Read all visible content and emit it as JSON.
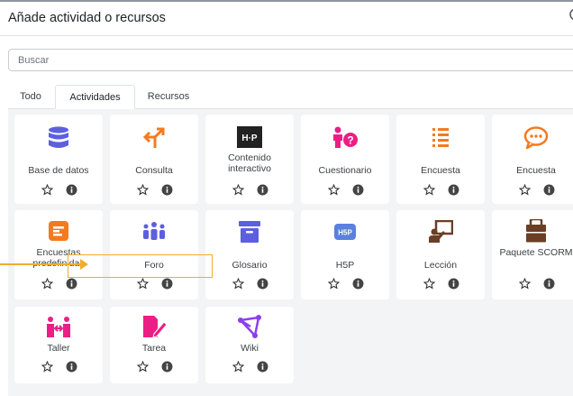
{
  "dialog": {
    "title": "Añade actividad o recursos",
    "close_icon": "close-icon"
  },
  "search": {
    "placeholder": "Buscar",
    "value": ""
  },
  "tabs": [
    {
      "label": "Todo",
      "active": false
    },
    {
      "label": "Actividades",
      "active": true
    },
    {
      "label": "Recursos",
      "active": false
    }
  ],
  "colors": {
    "blue": "#5b5fe0",
    "orange": "#f47a20",
    "pink": "#ec1e85",
    "purple": "#8b3ff0",
    "h5p_dark": "#222222",
    "h5p_blue": "#5a80e0",
    "brown": "#6b3e26",
    "highlight": "#f0ad2b"
  },
  "tiles": [
    {
      "label": "Base de datos",
      "icon": "database-icon"
    },
    {
      "label": "Consulta",
      "icon": "choice-icon"
    },
    {
      "label": "Contenido interactivo",
      "icon": "h5p-icon"
    },
    {
      "label": "Cuestionario",
      "icon": "quiz-icon"
    },
    {
      "label": "Encuesta",
      "icon": "survey-list-icon"
    },
    {
      "label": "Encuesta",
      "icon": "feedback-icon"
    },
    {
      "label": "Encuestas predefinidas",
      "icon": "predefined-survey-icon"
    },
    {
      "label": "Foro",
      "icon": "forum-icon"
    },
    {
      "label": "Glosario",
      "icon": "glossary-icon"
    },
    {
      "label": "H5P",
      "icon": "h5p-badge-icon"
    },
    {
      "label": "Lección",
      "icon": "lesson-icon"
    },
    {
      "label": "Paquete SCORM",
      "icon": "scorm-package-icon"
    },
    {
      "label": "Taller",
      "icon": "workshop-icon"
    },
    {
      "label": "Tarea",
      "icon": "assignment-icon"
    },
    {
      "label": "Wiki",
      "icon": "wiki-icon"
    }
  ]
}
